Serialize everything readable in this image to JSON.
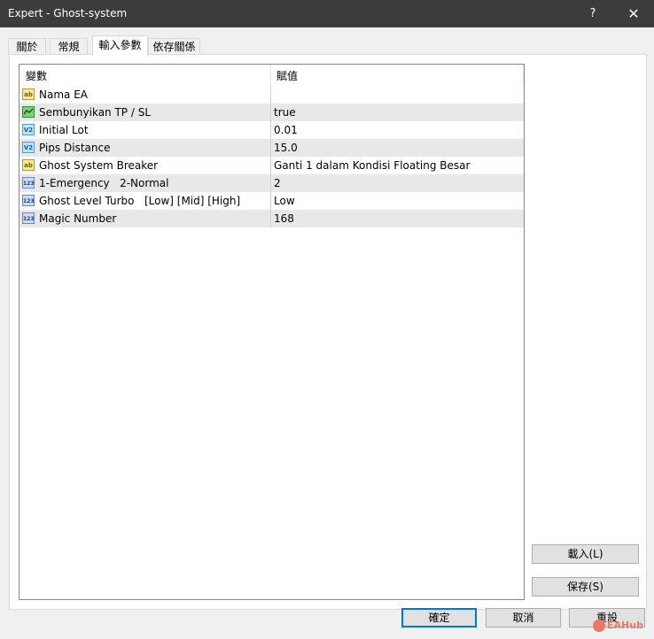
{
  "window": {
    "title": "Expert - Ghost-system",
    "help_glyph": "?",
    "close_glyph": "✕"
  },
  "tabs": [
    {
      "label": "關於"
    },
    {
      "label": "常規"
    },
    {
      "label": "輸入參數",
      "active": true
    },
    {
      "label": "依存關係"
    }
  ],
  "grid": {
    "col_variable": "變數",
    "col_value": "賦值",
    "rows": [
      {
        "icon": "string-icon",
        "icon_text": "ab",
        "name": "Nama EA",
        "value": ""
      },
      {
        "icon": "bool-icon",
        "icon_text": "",
        "name": "Sembunyikan TP / SL",
        "value": "true"
      },
      {
        "icon": "double-icon",
        "icon_text": "V2",
        "name": "Initial Lot",
        "value": "0.01"
      },
      {
        "icon": "double-icon",
        "icon_text": "V2",
        "name": "Pips Distance",
        "value": "15.0"
      },
      {
        "icon": "string-icon",
        "icon_text": "ab",
        "name": "Ghost System Breaker",
        "value": "Ganti 1 dalam Kondisi Floating Besar"
      },
      {
        "icon": "int-icon",
        "icon_text": "123",
        "name": "1-Emergency   2-Normal",
        "value": "2"
      },
      {
        "icon": "int-icon",
        "icon_text": "123",
        "name": "Ghost Level Turbo   [Low] [Mid] [High]",
        "value": "Low"
      },
      {
        "icon": "int-icon",
        "icon_text": "123",
        "name": "Magic Number",
        "value": "168"
      }
    ]
  },
  "side_buttons": {
    "load": "載入(L)",
    "save": "保存(S)"
  },
  "footer_buttons": {
    "ok": "確定",
    "cancel": "取消",
    "reset": "重設"
  },
  "watermark": {
    "text": "EAHub"
  }
}
